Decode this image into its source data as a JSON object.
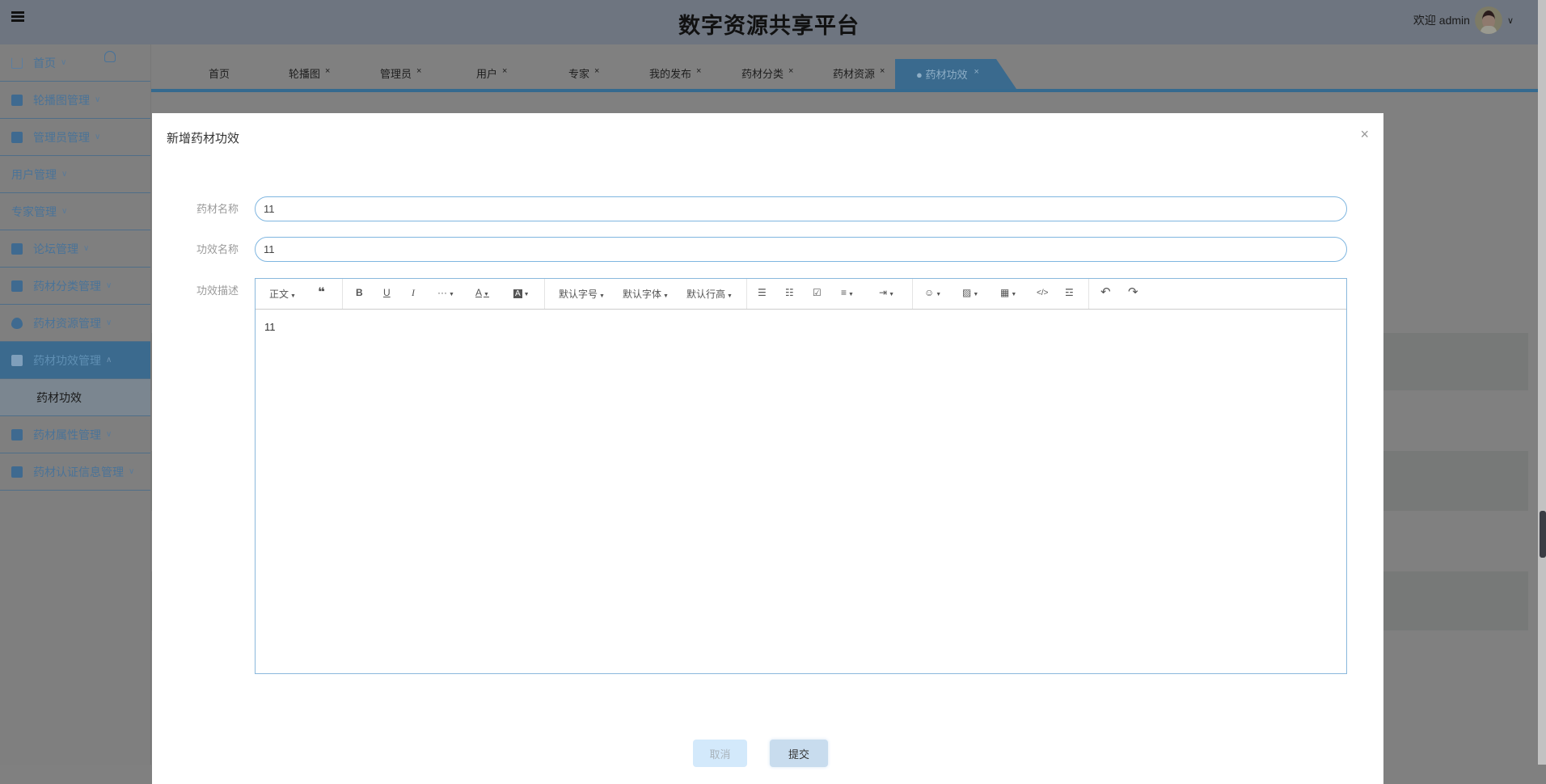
{
  "header": {
    "title": "数字资源共享平台",
    "welcome": "欢迎 admin",
    "menu_icon": "menu-fold-icon"
  },
  "sidebar": {
    "items": [
      {
        "label": "首页",
        "icon": "home-icon"
      },
      {
        "label": "轮播图管理",
        "icon": "picture-icon"
      },
      {
        "label": "管理员管理",
        "icon": "briefcase-icon"
      },
      {
        "label": "用户管理",
        "icon": "user-icon"
      },
      {
        "label": "专家管理",
        "icon": "user-icon"
      },
      {
        "label": "论坛管理",
        "icon": "wallet-icon"
      },
      {
        "label": "药材分类管理",
        "icon": "book-icon"
      },
      {
        "label": "药材资源管理",
        "icon": "drop-icon"
      },
      {
        "label": "药材功效管理",
        "icon": "box-icon",
        "expanded": true,
        "children": [
          {
            "label": "药材功效"
          }
        ]
      },
      {
        "label": "药材属性管理",
        "icon": "card-icon"
      },
      {
        "label": "药材认证信息管理",
        "icon": "monitor-icon"
      }
    ]
  },
  "tabs": [
    {
      "label": "首页"
    },
    {
      "label": "轮播图",
      "close": "×"
    },
    {
      "label": "管理员",
      "close": "×"
    },
    {
      "label": "用户",
      "close": "×"
    },
    {
      "label": "专家",
      "close": "×"
    },
    {
      "label": "我的发布",
      "close": "×"
    },
    {
      "label": "药材分类",
      "close": "×"
    },
    {
      "label": "药材资源",
      "close": "×"
    },
    {
      "label": "● 药材功效",
      "close": "×",
      "active": true
    }
  ],
  "modal": {
    "title": "新增药材功效",
    "close": "×",
    "fields": [
      {
        "label": "药材名称",
        "value": "11"
      },
      {
        "label": "功效名称",
        "value": "11"
      },
      {
        "label": "功效描述",
        "value": "11"
      }
    ],
    "toolbar": {
      "paragraph": "正文",
      "quote": "❝",
      "bold": "B",
      "underline": "U",
      "italic": "I",
      "more": "···",
      "font_color": "A",
      "bg_color": "A",
      "font_size": "默认字号",
      "font_family": "默认字体",
      "line_height": "默认行高",
      "bullet_list": "☰",
      "numbered_list": "☷",
      "todo": "☑",
      "align": "≡",
      "indent": "⇥",
      "emoji": "☺",
      "image": "▨",
      "table": "▦",
      "code": "</>",
      "divider": "☲",
      "undo": "↶",
      "redo": "↷"
    },
    "cancel": "取消",
    "submit": "提交"
  }
}
